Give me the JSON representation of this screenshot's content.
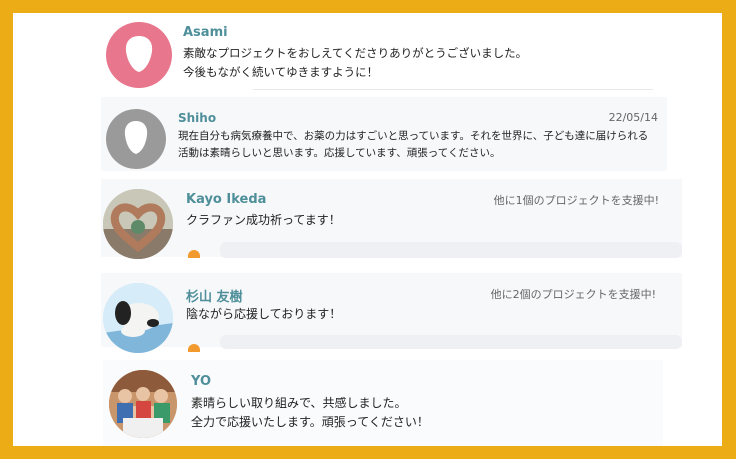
{
  "comments": [
    {
      "name": "Asami",
      "meta": "",
      "lines": [
        "素敵なプロジェクトをおしえてくださりありがとうございました。",
        "今後もながく続いてゆきますように！"
      ],
      "avatar": "default-pink"
    },
    {
      "name": "Shiho",
      "meta": "22/05/14",
      "lines": [
        "現在自分も病気療養中で、お薬の力はすごいと思っています。それを世界に、子ども達に届けられる",
        "活動は素晴らしいと思います。応援しています、頑張ってください。"
      ],
      "avatar": "default-gray"
    },
    {
      "name": "Kayo Ikeda",
      "meta": "他に1個のプロジェクトを支援中!",
      "lines": [
        "クラファン成功祈ってます！"
      ],
      "avatar": "heart-hands-photo"
    },
    {
      "name": "杉山 友樹",
      "meta": "他に2個のプロジェクトを支援中!",
      "lines": [
        "陰ながら応援しております！"
      ],
      "avatar": "plush-dog-photo"
    },
    {
      "name": "YO",
      "meta": "",
      "lines": [
        "素晴らしい取り組みで、共感しました。",
        "全力で応援いたします。頑張ってください！"
      ],
      "avatar": "group-photo"
    }
  ],
  "colors": {
    "frame": "#ecac16",
    "name": "#4e8f9a",
    "avatar_pink": "#e8768c",
    "avatar_gray": "#9a9a9a"
  }
}
